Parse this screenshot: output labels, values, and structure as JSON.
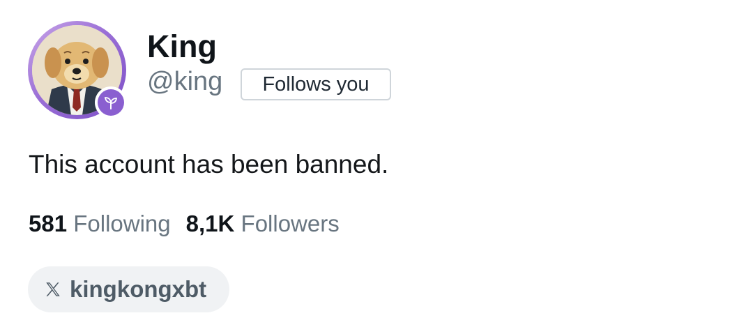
{
  "profile": {
    "display_name": "King",
    "handle": "@king",
    "follows_you_label": "Follows you",
    "bio": "This account has been banned.",
    "avatar_icon": "dog-in-suit-avatar",
    "badge_icon": "sprout-icon",
    "accent_color": "#8a5fd0"
  },
  "stats": {
    "following_count": "581",
    "following_label": "Following",
    "followers_count": "8,1K",
    "followers_label": "Followers"
  },
  "social": {
    "icon": "x-logo-icon",
    "handle": "kingkongxbt"
  }
}
